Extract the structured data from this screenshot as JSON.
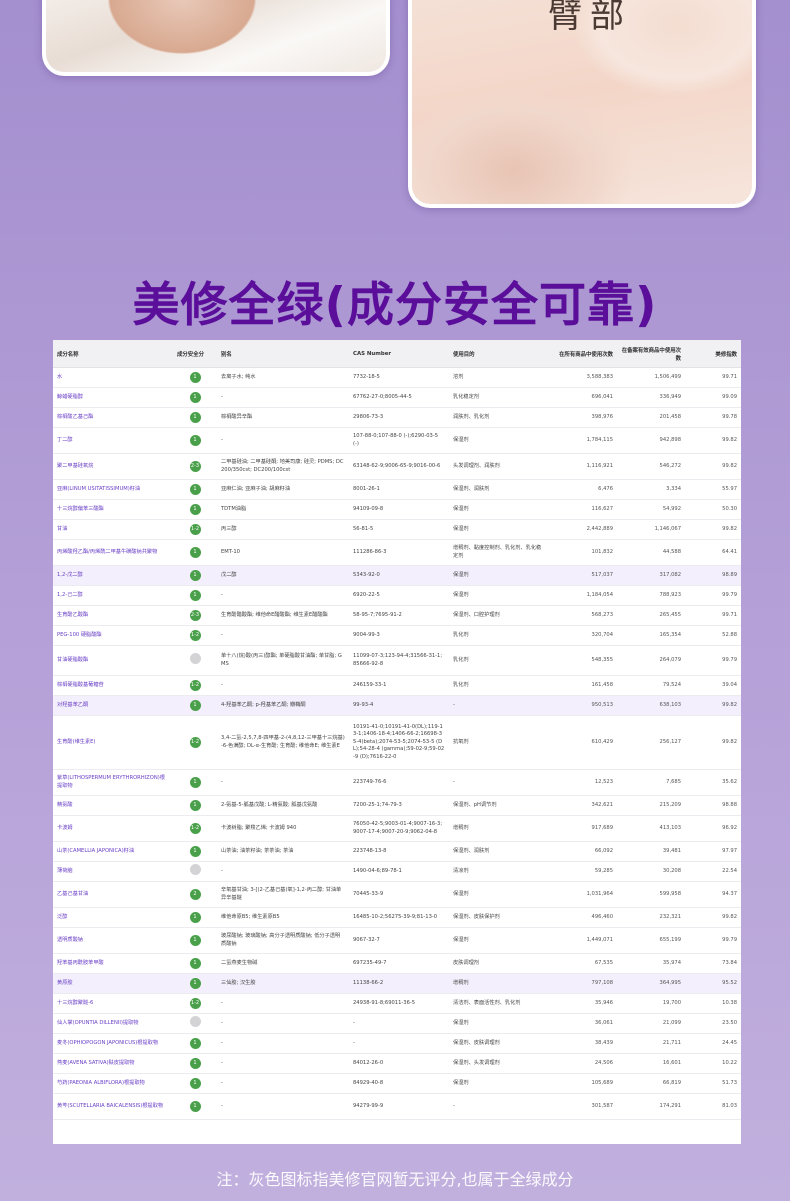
{
  "photos": {
    "right_label": "臂部"
  },
  "headline": "美修全绿(成分安全可靠)",
  "table": {
    "headers": {
      "name": "成分名称",
      "score": "成分安全分",
      "alias": "别名",
      "cas": "CAS Number",
      "usage": "使用目的",
      "count_all": "在所有商品中使用次数",
      "count_valid": "在备案有效商品中使用次数",
      "rate": "美修指数"
    },
    "rows": [
      {
        "name": "水",
        "score": "1",
        "gray": false,
        "alias": "去离子水; 纯水",
        "cas": "7732-18-5",
        "usage": "溶剂",
        "count_all": "3,588,383",
        "count_valid": "1,506,499",
        "rate": "99.71",
        "h": 20
      },
      {
        "name": "鲸蜡硬脂醇",
        "score": "1",
        "gray": false,
        "alias": "-",
        "cas": "67762-27-0;8005-44-5",
        "usage": "乳化稳定剂",
        "count_all": "696,041",
        "count_valid": "336,949",
        "rate": "99.09",
        "h": 20
      },
      {
        "name": "棕榈酸乙基己酯",
        "score": "1",
        "gray": false,
        "alias": "棕榈酸异辛酯",
        "cas": "29806-73-3",
        "usage": "润肤剂、乳化剂",
        "count_all": "398,976",
        "count_valid": "201,458",
        "rate": "99.78",
        "h": 20
      },
      {
        "name": "丁二醇",
        "score": "1",
        "gray": false,
        "alias": "-",
        "cas": "107-88-0;107-88-0 (-);6290-03-5 (-)",
        "usage": "保湿剂",
        "count_all": "1,784,115",
        "count_valid": "942,898",
        "rate": "99.82",
        "h": 26
      },
      {
        "name": "聚二甲基硅氧烷",
        "score": "2-3",
        "gray": false,
        "alias": "二甲基硅油; 二甲基硅酮; 地美司康; 硅灵; PDMS; DC200/350cst; DC200/100cst",
        "cas": "63148-62-9;9006-65-9;9016-00-6",
        "usage": "头发调理剂、润肤剂",
        "count_all": "1,116,921",
        "count_valid": "546,272",
        "rate": "99.82",
        "h": 26
      },
      {
        "name": "亚麻(LINUM USITATISSIMUM)籽油",
        "score": "1",
        "gray": false,
        "alias": "亚麻仁油; 亚麻子油; 胡麻籽油",
        "cas": "8001-26-1",
        "usage": "保湿剂、润肤剂",
        "count_all": "6,476",
        "count_valid": "3,334",
        "rate": "55.97",
        "h": 20
      },
      {
        "name": "十三烷醇偏苯三酸酯",
        "score": "1",
        "gray": false,
        "alias": "TDTM油脂",
        "cas": "94109-09-8",
        "usage": "保湿剂",
        "count_all": "116,627",
        "count_valid": "54,992",
        "rate": "50.30",
        "h": 20
      },
      {
        "name": "甘油",
        "score": "1-2",
        "gray": false,
        "alias": "丙三醇",
        "cas": "56-81-5",
        "usage": "保湿剂",
        "count_all": "2,442,889",
        "count_valid": "1,146,067",
        "rate": "99.82",
        "h": 20
      },
      {
        "name": "丙烯酸羟乙酯/丙烯酰二甲基牛磺酸钠共聚物",
        "score": "1",
        "gray": false,
        "alias": "EMT-10",
        "cas": "111286-86-3",
        "usage": "增稠剂、黏度控制剂、乳化剂、乳化稳定剂",
        "count_all": "101,832",
        "count_valid": "44,588",
        "rate": "64.41",
        "h": 26
      },
      {
        "name": "1,2-戊二醇",
        "score": "1",
        "gray": false,
        "alias": "戊二醇",
        "cas": "5343-92-0",
        "usage": "保湿剂",
        "count_all": "517,037",
        "count_valid": "317,082",
        "rate": "98.89",
        "h": 20,
        "hl": true
      },
      {
        "name": "1,2-己二醇",
        "score": "1",
        "gray": false,
        "alias": "-",
        "cas": "6920-22-5",
        "usage": "保湿剂",
        "count_all": "1,184,054",
        "count_valid": "788,923",
        "rate": "99.79",
        "h": 20
      },
      {
        "name": "生育酚乙酸酯",
        "score": "2-3",
        "gray": false,
        "alias": "生育酚醋酸酯; 维他命E醋酸酯; 维生素E醋酸酯",
        "cas": "58-95-7;7695-91-2",
        "usage": "保湿剂、口腔护理剂",
        "count_all": "568,273",
        "count_valid": "265,455",
        "rate": "99.71",
        "h": 20
      },
      {
        "name": "PEG-100 硬脂酸酯",
        "score": "1-2",
        "gray": false,
        "alias": "-",
        "cas": "9004-99-3",
        "usage": "乳化剂",
        "count_all": "320,704",
        "count_valid": "165,354",
        "rate": "52.88",
        "h": 20
      },
      {
        "name": "甘油硬脂酸酯",
        "score": "",
        "gray": true,
        "alias": "单十八(烷)酸(丙三)醇酯; 单硬脂酸甘油酯; 单甘脂; GMS",
        "cas": "11099-07-3;123-94-4;31566-31-1;85666-92-8",
        "usage": "乳化剂",
        "count_all": "548,355",
        "count_valid": "264,079",
        "rate": "99.79",
        "h": 30
      },
      {
        "name": "棕榈硬脂酸基葡糖苷",
        "score": "1-2",
        "gray": false,
        "alias": "-",
        "cas": "246159-33-1",
        "usage": "乳化剂",
        "count_all": "161,458",
        "count_valid": "79,524",
        "rate": "39.04",
        "h": 20
      },
      {
        "name": "对羟基苯乙酮",
        "score": "1",
        "gray": false,
        "alias": "4-羟基苯乙酮; p-羟基苯乙酮; 瓣鞘酮",
        "cas": "99-93-4",
        "usage": "-",
        "count_all": "950,513",
        "count_valid": "638,103",
        "rate": "99.82",
        "h": 20,
        "hl": true
      },
      {
        "name": "生育酚(维生素E)",
        "score": "1-2",
        "gray": false,
        "alias": "3,4-二氢-2,5,7,8-四甲基-2-(4,8,12-三甲基十三烷基)-6-色满醇; DL-α-生育酚; 生育酚; 维他命E; 维生素E",
        "cas": "10191-41-0;10191-41-0(DL);119-13-1;1406-18-4;1406-66-2;16698-35-4(beta);2074-53-5;2074-53-5 (DL);54-28-4 (gamma);59-02-9;59-02-9 (D);7616-22-0",
        "usage": "抗氧剂",
        "count_all": "610,429",
        "count_valid": "256,127",
        "rate": "99.82",
        "h": 54
      },
      {
        "name": "紫草(LITHOSPERMUM ERYTHRORHIZON)根提取物",
        "score": "1",
        "gray": false,
        "alias": "-",
        "cas": "223749-76-6",
        "usage": "-",
        "count_all": "12,523",
        "count_valid": "7,685",
        "rate": "35.62",
        "h": 26
      },
      {
        "name": "精氨酸",
        "score": "1",
        "gray": false,
        "alias": "2-氨基-5-胍基戊酸; L-精氨酸; 胍基戊氨酸",
        "cas": "7200-25-1;74-79-3",
        "usage": "保湿剂、pH调节剂",
        "count_all": "342,621",
        "count_valid": "215,209",
        "rate": "98.88",
        "h": 20
      },
      {
        "name": "卡波姆",
        "score": "1-2",
        "gray": false,
        "alias": "卡波树脂; 聚羧乙烯; 卡波姆 940",
        "cas": "76050-42-5;9003-01-4;9007-16-3;9007-17-4;9007-20-9;9062-04-8",
        "usage": "增稠剂",
        "count_all": "917,689",
        "count_valid": "413,103",
        "rate": "96.92",
        "h": 26
      },
      {
        "name": "山茶(CAMELLIA JAPONICA)籽油",
        "score": "1",
        "gray": false,
        "alias": "山茶油; 油茶籽油; 茶茶油; 茶油",
        "cas": "223748-13-8",
        "usage": "保湿剂、润肤剂",
        "count_all": "66,092",
        "count_valid": "39,481",
        "rate": "97.97",
        "h": 20
      },
      {
        "name": "薄荷脑",
        "score": "",
        "gray": true,
        "alias": "-",
        "cas": "1490-04-6;89-78-1",
        "usage": "清凉剂",
        "count_all": "59,285",
        "count_valid": "30,208",
        "rate": "22.54",
        "h": 20
      },
      {
        "name": "乙基己基甘油",
        "score": "2",
        "gray": false,
        "alias": "辛氧基甘油; 3-[(2-乙基己基)氧]-1,2-丙二醇; 甘油单异辛基醚",
        "cas": "70445-33-9",
        "usage": "保湿剂",
        "count_all": "1,031,964",
        "count_valid": "599,958",
        "rate": "94.37",
        "h": 26
      },
      {
        "name": "泛醇",
        "score": "1",
        "gray": false,
        "alias": "维他命原B5; 维生素原B5",
        "cas": "16485-10-2;56275-39-9;81-13-0",
        "usage": "保湿剂、皮肤保护剂",
        "count_all": "496,460",
        "count_valid": "232,321",
        "rate": "99.82",
        "h": 20
      },
      {
        "name": "透明质酸钠",
        "score": "1",
        "gray": false,
        "alias": "玻尿酸钠; 玻璃酸钠; 高分子透明质酸钠; 低分子透明质酸钠",
        "cas": "9067-32-7",
        "usage": "保湿剂",
        "count_all": "1,449,071",
        "count_valid": "655,199",
        "rate": "99.79",
        "h": 26
      },
      {
        "name": "羟苯基丙酰胺苯甲酸",
        "score": "1",
        "gray": false,
        "alias": "二氢燕麦生物碱",
        "cas": "697235-49-7",
        "usage": "皮肤调理剂",
        "count_all": "67,535",
        "count_valid": "35,974",
        "rate": "73.84",
        "h": 20
      },
      {
        "name": "黄原胶",
        "score": "1",
        "gray": false,
        "alias": "三仙胶; 汉生胶",
        "cas": "11138-66-2",
        "usage": "增稠剂",
        "count_all": "797,108",
        "count_valid": "364,995",
        "rate": "95.52",
        "h": 20,
        "hl": true
      },
      {
        "name": "十三烷醇聚醚-6",
        "score": "1-2",
        "gray": false,
        "alias": "-",
        "cas": "24938-91-8;69011-36-5",
        "usage": "清洁剂、表面活性剂、乳化剂",
        "count_all": "35,946",
        "count_valid": "19,700",
        "rate": "10.38",
        "h": 20
      },
      {
        "name": "仙人掌(OPUNTIA DILLENII)提取物",
        "score": "",
        "gray": true,
        "alias": "-",
        "cas": "-",
        "usage": "保湿剂",
        "count_all": "36,061",
        "count_valid": "21,099",
        "rate": "23.50",
        "h": 20
      },
      {
        "name": "麦冬(OPHIOPOGON JAPONICUS)根提取物",
        "score": "1",
        "gray": false,
        "alias": "-",
        "cas": "-",
        "usage": "保湿剂、皮肤调理剂",
        "count_all": "38,439",
        "count_valid": "21,711",
        "rate": "24.45",
        "h": 20
      },
      {
        "name": "燕麦(AVENA SATIVA)麸皮提取物",
        "score": "1",
        "gray": false,
        "alias": "-",
        "cas": "84012-26-0",
        "usage": "保湿剂、头发调理剂",
        "count_all": "24,506",
        "count_valid": "16,601",
        "rate": "10.22",
        "h": 20
      },
      {
        "name": "芍药(PAEONIA ALBIFLORA)根提取物",
        "score": "1",
        "gray": false,
        "alias": "-",
        "cas": "84929-40-8",
        "usage": "保湿剂",
        "count_all": "105,689",
        "count_valid": "66,819",
        "rate": "51.73",
        "h": 20
      },
      {
        "name": "黄芩(SCUTELLARIA BAICALENSIS)根提取物",
        "score": "1",
        "gray": false,
        "alias": "-",
        "cas": "94279-99-9",
        "usage": "-",
        "count_all": "301,587",
        "count_valid": "174,291",
        "rate": "81.03",
        "h": 26
      }
    ]
  },
  "footnote": "注：灰色图标指美修官网暂无评分,也属于全绿成分"
}
